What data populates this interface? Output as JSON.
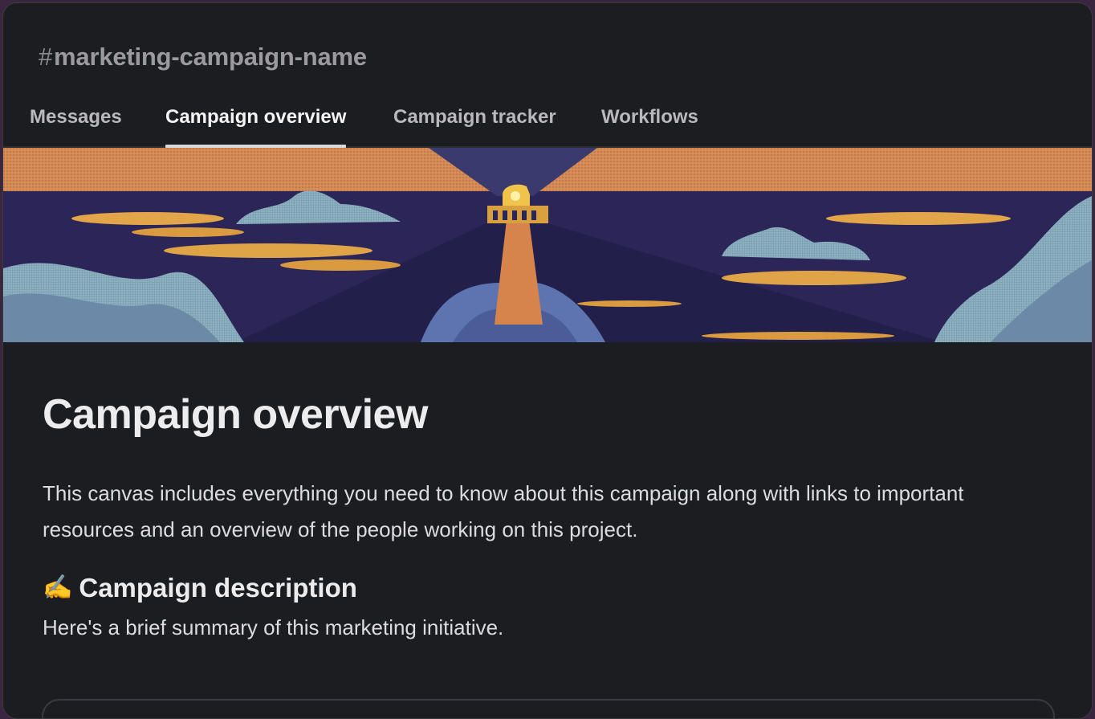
{
  "channel": {
    "hash": "#",
    "name": "marketing-campaign-name"
  },
  "tabs": [
    {
      "label": "Messages",
      "active": false
    },
    {
      "label": "Campaign overview",
      "active": true
    },
    {
      "label": "Campaign tracker",
      "active": false
    },
    {
      "label": "Workflows",
      "active": false
    }
  ],
  "banner": {
    "illustration": "lighthouse-night-illustration"
  },
  "canvas": {
    "title": "Campaign overview",
    "intro": "This canvas includes everything you need to know about this campaign along with links to important resources and an overview of the people working on this project.",
    "section": {
      "emoji": "✍️",
      "emoji_icon": "writing-hand-icon",
      "heading": "Campaign description",
      "subtext": "Here's a brief summary of this marketing initiative."
    }
  },
  "colors": {
    "background": "#1c1d21",
    "tab_underline": "#d9d9e0",
    "banner_sky": "#2a2452",
    "banner_orange": "#d98c54",
    "banner_cloud": "#8fb6c2"
  }
}
